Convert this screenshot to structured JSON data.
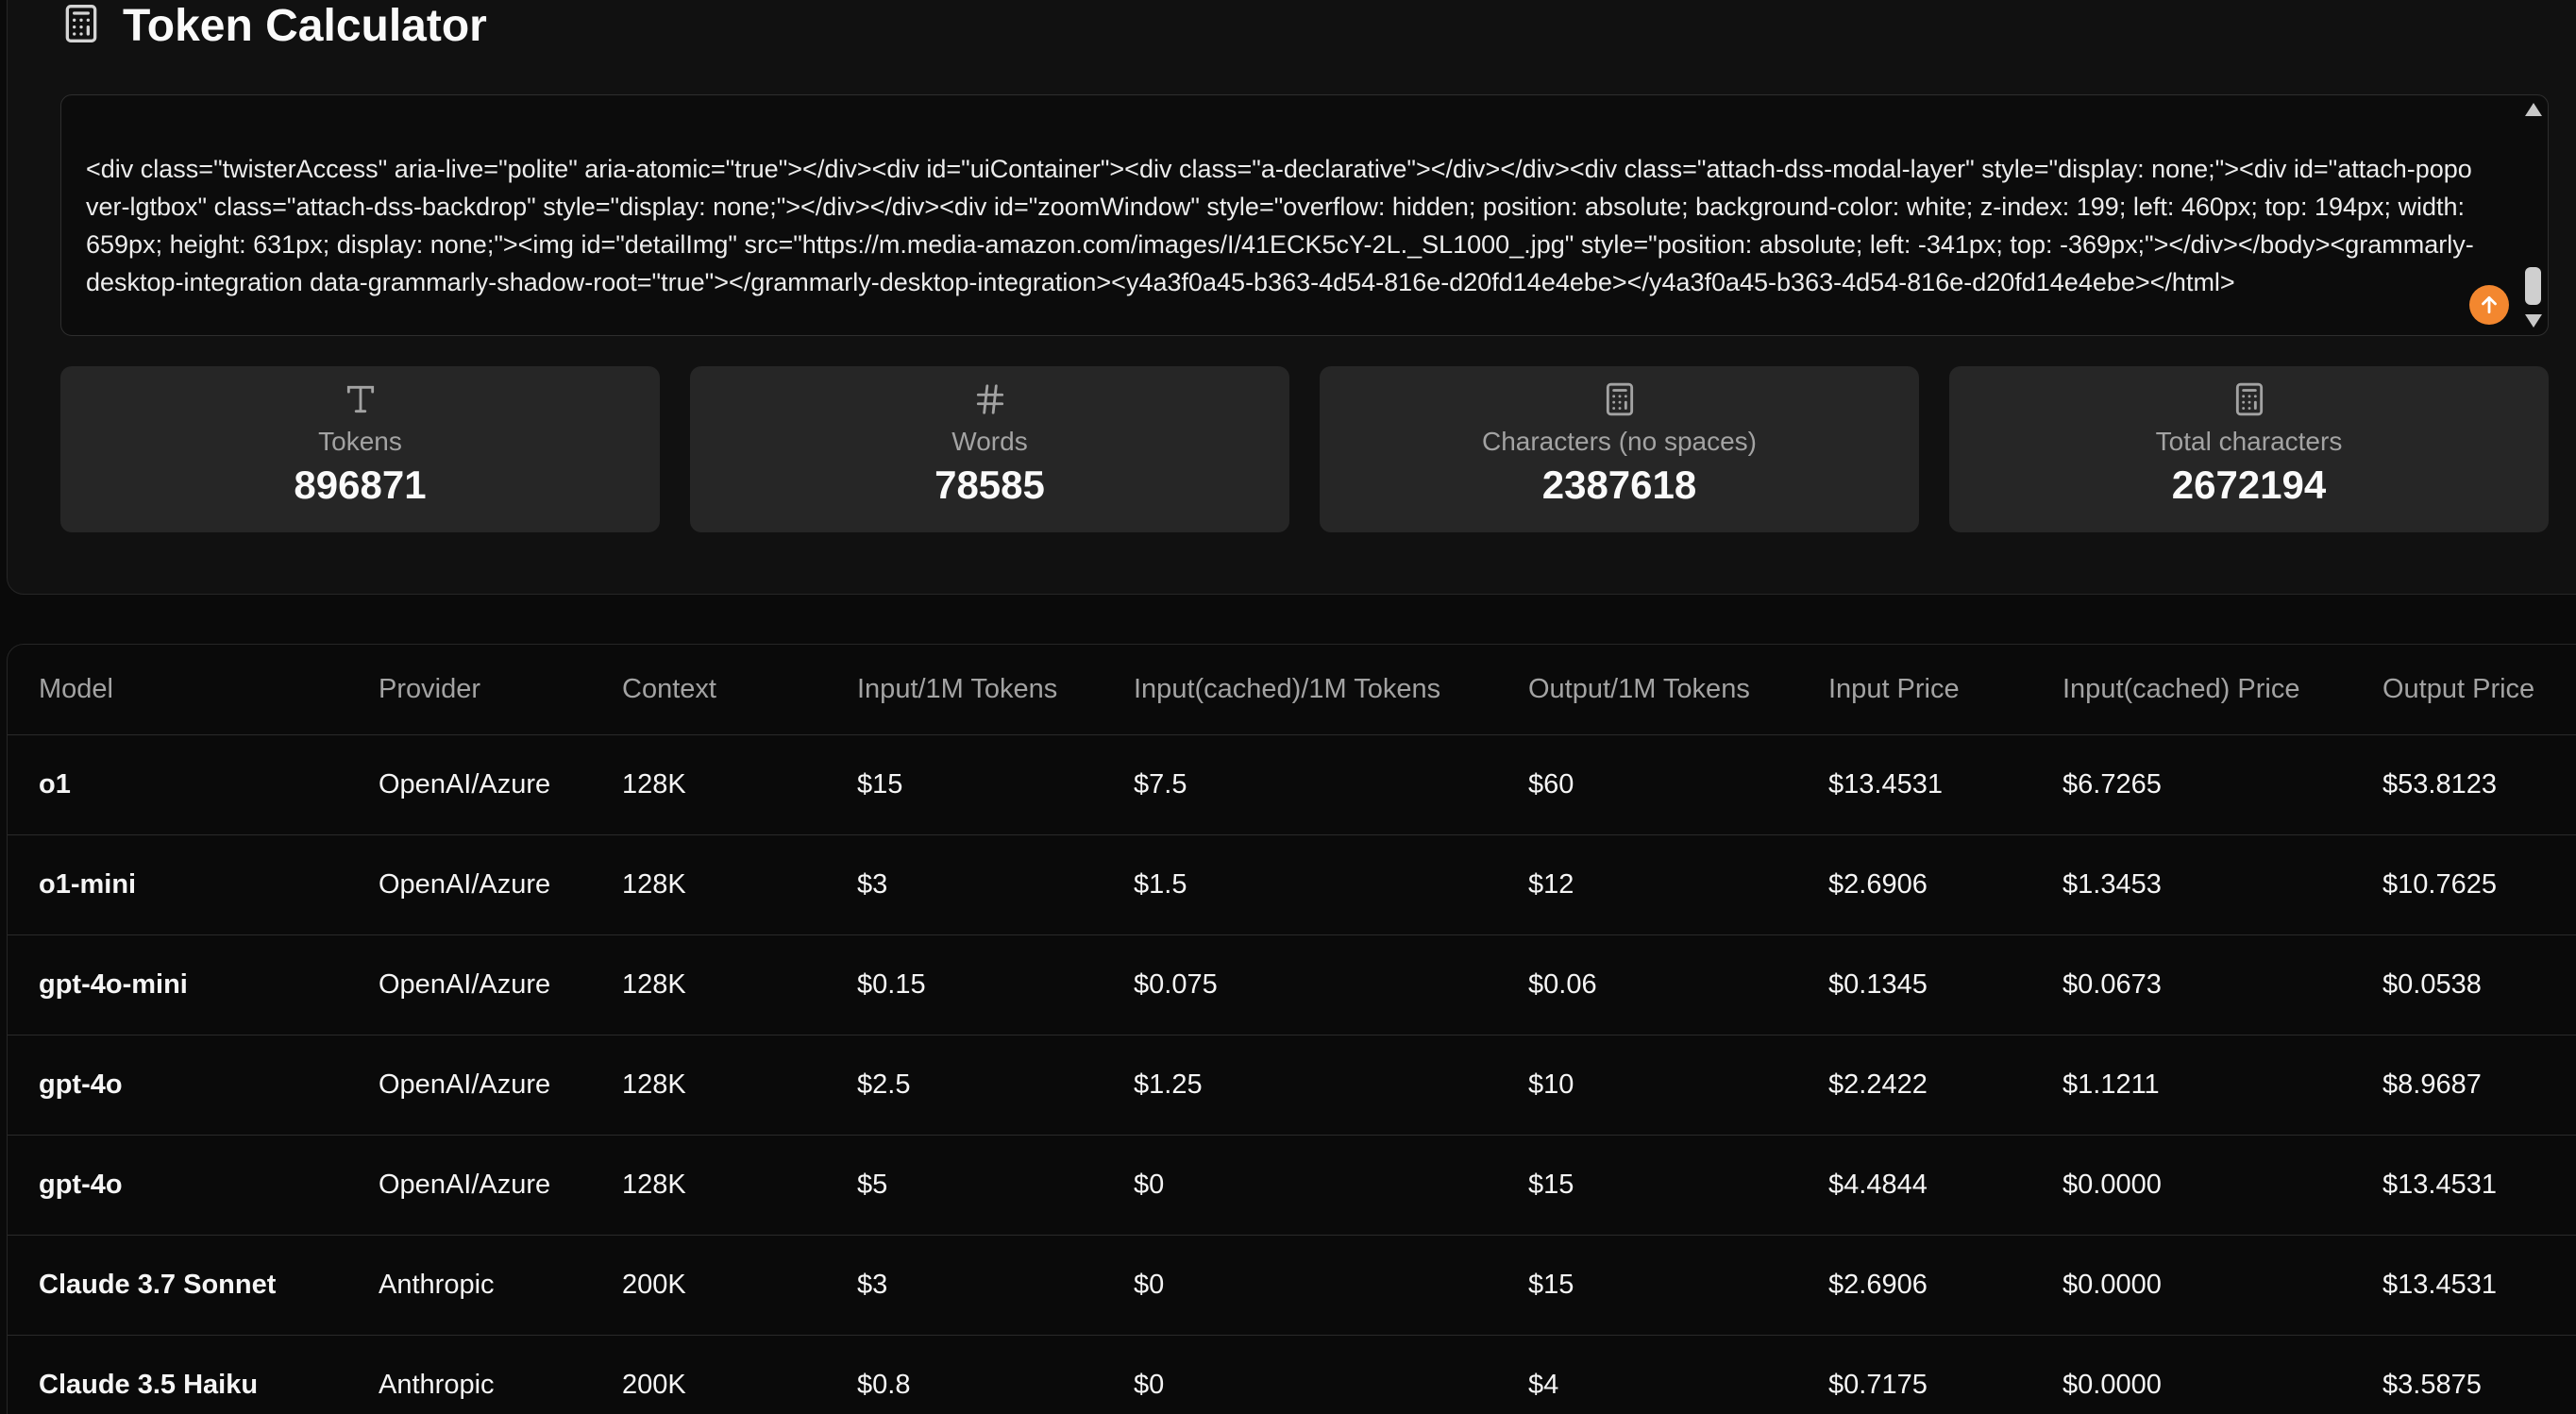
{
  "header": {
    "title": "Token Calculator",
    "icon": "calculator-icon"
  },
  "input": {
    "text": "<div class=\"twisterAccess\" aria-live=\"polite\" aria-atomic=\"true\"></div><div id=\"uiContainer\"><div class=\"a-declarative\"></div></div><div class=\"attach-dss-modal-layer\" style=\"display: none;\"><div id=\"attach-popover-lgtbox\" class=\"attach-dss-backdrop\" style=\"display: none;\"></div></div><div id=\"zoomWindow\" style=\"overflow: hidden; position: absolute; background-color: white; z-index: 199; left: 460px; top: 194px; width: 659px; height: 631px; display: none;\"><img id=\"detailImg\" src=\"https://m.media-amazon.com/images/I/41ECK5cY-2L._SL1000_.jpg\" style=\"position: absolute; left: -341px; top: -369px;\"></div></body><grammarly-desktop-integration data-grammarly-shadow-root=\"true\"></grammarly-desktop-integration><y4a3f0a45-b363-4d54-816e-d20fd14e4ebe></y4a3f0a45-b363-4d54-816e-d20fd14e4ebe></html>"
  },
  "stats": [
    {
      "label": "Tokens",
      "value": "896871",
      "icon": "text-type-icon"
    },
    {
      "label": "Words",
      "value": "78585",
      "icon": "hash-icon"
    },
    {
      "label": "Characters (no spaces)",
      "value": "2387618",
      "icon": "calculator-icon"
    },
    {
      "label": "Total characters",
      "value": "2672194",
      "icon": "calculator-icon"
    }
  ],
  "table": {
    "headers": [
      "Model",
      "Provider",
      "Context",
      "Input/1M Tokens",
      "Input(cached)/1M Tokens",
      "Output/1M Tokens",
      "Input Price",
      "Input(cached) Price",
      "Output Price"
    ],
    "rows": [
      [
        "o1",
        "OpenAI/Azure",
        "128K",
        "$15",
        "$7.5",
        "$60",
        "$13.4531",
        "$6.7265",
        "$53.8123"
      ],
      [
        "o1-mini",
        "OpenAI/Azure",
        "128K",
        "$3",
        "$1.5",
        "$12",
        "$2.6906",
        "$1.3453",
        "$10.7625"
      ],
      [
        "gpt-4o-mini",
        "OpenAI/Azure",
        "128K",
        "$0.15",
        "$0.075",
        "$0.06",
        "$0.1345",
        "$0.0673",
        "$0.0538"
      ],
      [
        "gpt-4o",
        "OpenAI/Azure",
        "128K",
        "$2.5",
        "$1.25",
        "$10",
        "$2.2422",
        "$1.1211",
        "$8.9687"
      ],
      [
        "gpt-4o",
        "OpenAI/Azure",
        "128K",
        "$5",
        "$0",
        "$15",
        "$4.4844",
        "$0.0000",
        "$13.4531"
      ],
      [
        "Claude 3.7 Sonnet",
        "Anthropic",
        "200K",
        "$3",
        "$0",
        "$15",
        "$2.6906",
        "$0.0000",
        "$13.4531"
      ],
      [
        "Claude 3.5 Haiku",
        "Anthropic",
        "200K",
        "$0.8",
        "$0",
        "$4",
        "$0.7175",
        "$0.0000",
        "$3.5875"
      ]
    ]
  },
  "colors": {
    "accent": "#f3872f",
    "background": "#0a0a0a",
    "card": "#262626"
  }
}
